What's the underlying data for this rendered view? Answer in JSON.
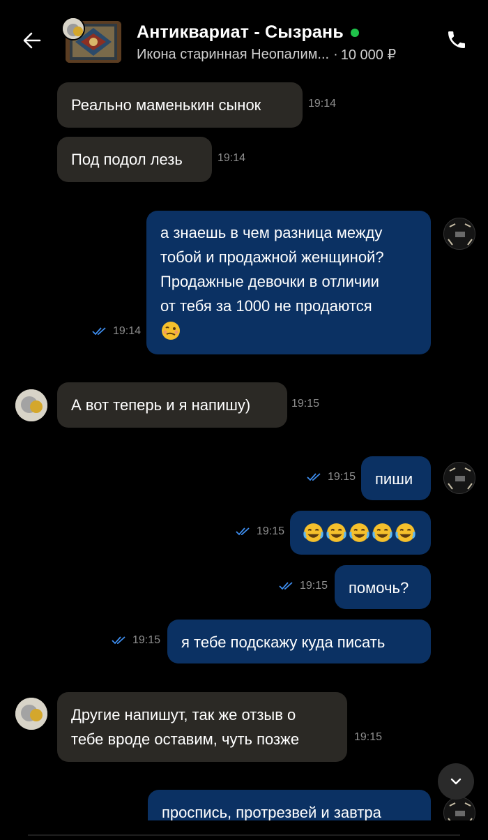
{
  "header": {
    "title": "Антиквариат - Сызрань",
    "product": "Икона старинная Неопалим...",
    "price": "10 000 ₽",
    "online_color": "#1fc34a"
  },
  "icons": {
    "back": "arrow-left-icon",
    "call": "phone-icon",
    "read": "double-check-icon",
    "scroll": "chevron-down-icon"
  },
  "messages": [
    {
      "dir": "in",
      "text": "Реально маменькин сынок",
      "time": "19:14"
    },
    {
      "dir": "in",
      "text": "Под подол лезь",
      "time": "19:14"
    },
    {
      "dir": "out",
      "lines": [
        "а знаешь в чем разница между",
        "тобой и продажной женщиной?",
        "Продажные девочки в отличии",
        "от тебя за 1000 не продаются"
      ],
      "emoji": "woozy-face",
      "time": "19:14"
    },
    {
      "dir": "in",
      "text": "А вот теперь и я напишу)",
      "time": "19:15"
    },
    {
      "dir": "out",
      "text": "пиши",
      "time": "19:15"
    },
    {
      "dir": "out",
      "emoji": "joy x5",
      "time": "19:15"
    },
    {
      "dir": "out",
      "text": "помочь?",
      "time": "19:15"
    },
    {
      "dir": "out",
      "text": "я тебе подскажу куда писать",
      "time": "19:15"
    },
    {
      "dir": "in",
      "lines": [
        "Другие напишут, так же отзыв о",
        "тебе вроде оставим, чуть позже"
      ],
      "time": "19:15"
    },
    {
      "dir": "out",
      "text": "проспись, протрезвей и завтра",
      "time": ""
    }
  ],
  "colors": {
    "incoming": "#2b2925",
    "outgoing": "#0b3163",
    "ticks": "#3e8ef0"
  }
}
